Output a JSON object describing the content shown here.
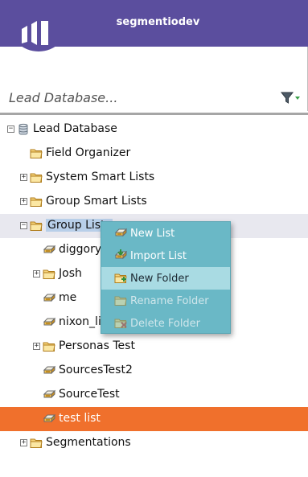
{
  "header": {
    "title": "segmentiodev"
  },
  "search": {
    "placeholder": "Lead Database..."
  },
  "tree": {
    "root": {
      "label": "Lead Database",
      "toggle": "−"
    },
    "items": [
      {
        "label": "Field Organizer"
      },
      {
        "label": "System Smart Lists",
        "toggle": "+"
      },
      {
        "label": "Group Smart Lists",
        "toggle": "+"
      },
      {
        "label": "Group Lists",
        "toggle": "−"
      },
      {
        "label": "diggory-"
      },
      {
        "label": "Josh",
        "toggle": "+"
      },
      {
        "label": "me"
      },
      {
        "label": "nixon_lis"
      },
      {
        "label": "Personas Test",
        "toggle": "+"
      },
      {
        "label": "SourcesTest2"
      },
      {
        "label": "SourceTest"
      },
      {
        "label": "test list"
      },
      {
        "label": "Segmentations",
        "toggle": "+"
      }
    ]
  },
  "context_menu": {
    "items": [
      {
        "label": "New List",
        "state": "enabled"
      },
      {
        "label": "Import List",
        "state": "enabled"
      },
      {
        "label": "New Folder",
        "state": "hovered"
      },
      {
        "label": "Rename Folder",
        "state": "disabled"
      },
      {
        "label": "Delete Folder",
        "state": "disabled"
      }
    ]
  },
  "colors": {
    "header": "#5b4e9e",
    "selected_row": "#f0702c",
    "menu": "#6ab8c6",
    "menu_hover": "#a9dbe3",
    "text_highlight": "#b8cfe9"
  }
}
